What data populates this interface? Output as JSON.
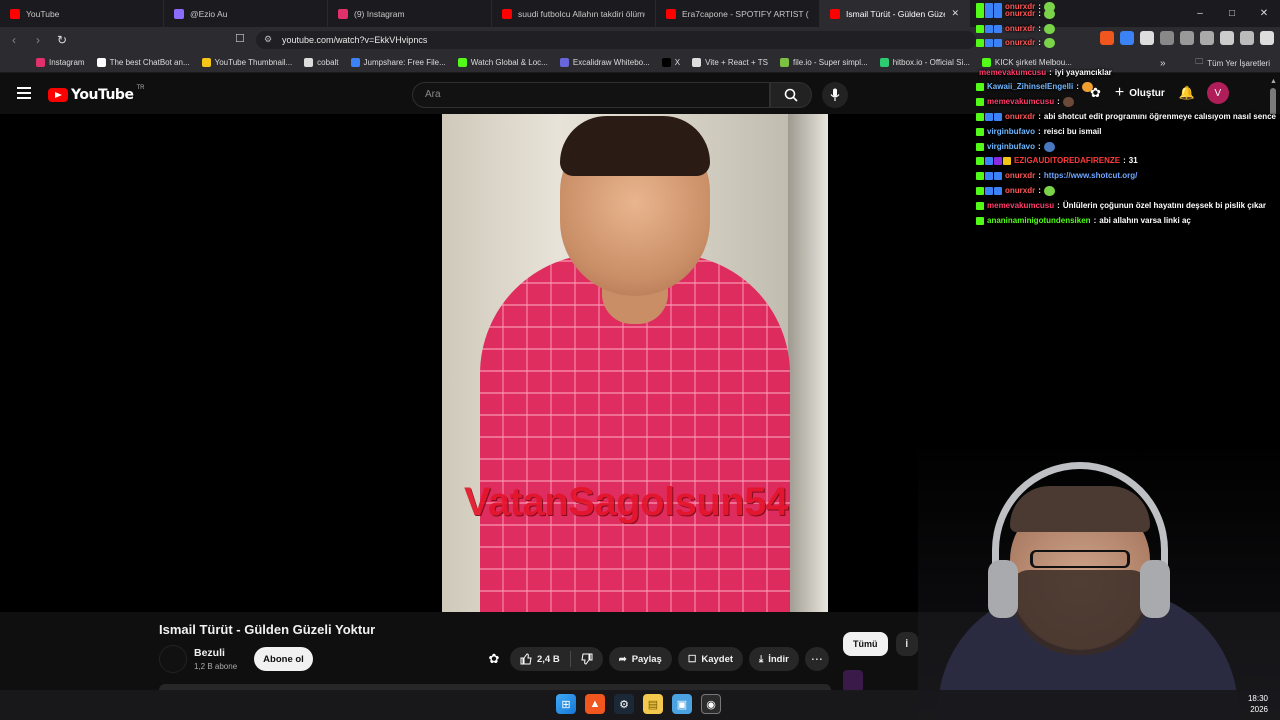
{
  "browser": {
    "tabs": [
      {
        "title": "YouTube",
        "color": "#ff0000"
      },
      {
        "title": "@Ezio Au",
        "color": "#8c6bff"
      },
      {
        "title": "(9) Instagram",
        "color": "#e1306c"
      },
      {
        "title": "suudi futbolcu Allahın takdiri ölümü",
        "color": "#ff0000"
      },
      {
        "title": "Era7capone - SPOTIFY ARTIST (Offici",
        "color": "#ff0000"
      },
      {
        "title": "Ismail Türüt - Gülden Güzeli Y",
        "color": "#ff0000",
        "active": true
      }
    ],
    "url": "youtube.com/watch?v=EkkVHvipncs",
    "bookmarks": [
      {
        "label": "Instagram",
        "color": "#e1306c"
      },
      {
        "label": "The best ChatBot an...",
        "color": "#ffffff"
      },
      {
        "label": "YouTube Thumbnail...",
        "color": "#f5c518"
      },
      {
        "label": "cobalt",
        "color": "#dddddd"
      },
      {
        "label": "Jumpshare: Free File...",
        "color": "#3b82f6"
      },
      {
        "label": "Watch Global & Loc...",
        "color": "#53fc18"
      },
      {
        "label": "Excalidraw Whitebo...",
        "color": "#6965db"
      },
      {
        "label": "X",
        "color": "#000000"
      },
      {
        "label": "Vite + React + TS",
        "color": "#dddddd"
      },
      {
        "label": "file.io - Super simpl...",
        "color": "#7cc142"
      },
      {
        "label": "hitbox.io - Official Si...",
        "color": "#2ecc71"
      },
      {
        "label": "KICK şirketi Melbou...",
        "color": "#53fc18"
      }
    ],
    "all_bookmarks": "Tüm Yer İşaretleri",
    "window_controls": [
      "–",
      "□",
      "✕"
    ]
  },
  "youtube": {
    "logo": "YouTube",
    "region": "TR",
    "search_placeholder": "Ara",
    "create_label": "Oluştur",
    "avatar_letter": "V",
    "video": {
      "title": "Ismail Türüt - Gülden Güzeli Yoktur",
      "watermark": "VatanSagolsun54",
      "channel": "Bezuli",
      "subscribers": "1,2 B abone",
      "subscribe_label": "Abone ol",
      "likes": "2,4 B",
      "share_label": "Paylaş",
      "save_label": "Kaydet",
      "download_label": "İndir"
    },
    "chips": [
      "Tümü",
      "İ"
    ]
  },
  "chat": [
    {
      "user": "onurxdr",
      "user_color": "#ff5555",
      "msg": "",
      "emote": "#7bd34a",
      "badges": [
        "#53fc18",
        "#3b82f6",
        "#3b82f6"
      ]
    },
    {
      "user": "onurxdr",
      "user_color": "#ff5555",
      "msg": "",
      "emote": "#7bd34a",
      "badges": [
        "#53fc18",
        "#3b82f6",
        "#3b82f6"
      ]
    },
    {
      "user": "onurxdr",
      "user_color": "#ff5555",
      "msg": "",
      "emote": "#7bd34a",
      "badges": [
        "#53fc18",
        "#3b82f6",
        "#3b82f6"
      ]
    },
    {
      "user": "onurxdr",
      "user_color": "#ff5555",
      "msg": "",
      "emote": "#7bd34a",
      "badges": [
        "#53fc18",
        "#3b82f6",
        "#3b82f6"
      ]
    },
    {
      "user": "memevakumcusu",
      "user_color": "#ff3b6b",
      "msg": "iyi yayamcıklar",
      "emote": "",
      "badges": []
    },
    {
      "user": "Kawaii_ZihinselEngelli",
      "user_color": "#6fb7ff",
      "msg": "",
      "emote": "#f0a030",
      "badges": [
        "#53fc18"
      ]
    },
    {
      "user": "memevakumcusu",
      "user_color": "#ff3b6b",
      "msg": "",
      "emote": "#6b4a3a",
      "badges": [
        "#53fc18"
      ]
    },
    {
      "user": "onurxdr",
      "user_color": "#ff5555",
      "msg": "abi shotcut edit programını öğrenmeye calısıyom nasıl sence",
      "emote": "",
      "badges": [
        "#53fc18",
        "#3b82f6",
        "#3b82f6"
      ]
    },
    {
      "user": "virginbufavo",
      "user_color": "#6fb7ff",
      "msg": "reisci bu ismail",
      "emote": "",
      "badges": [
        "#53fc18"
      ]
    },
    {
      "user": "virginbufavo",
      "user_color": "#6fb7ff",
      "msg": "",
      "emote": "#4a78c0",
      "badges": [
        "#53fc18"
      ]
    },
    {
      "user": "EZIGAUDITOREDAFIRENZE",
      "user_color": "#ff3b3b",
      "msg": "31",
      "emote": "",
      "badges": [
        "#53fc18",
        "#3b82f6",
        "#8a2be2",
        "#f5c518"
      ]
    },
    {
      "user": "onurxdr",
      "user_color": "#ff5555",
      "msg": "",
      "link": "https://www.shotcut.org/",
      "emote": "",
      "badges": [
        "#53fc18",
        "#3b82f6",
        "#3b82f6"
      ]
    },
    {
      "user": "onurxdr",
      "user_color": "#ff5555",
      "msg": "",
      "emote": "#7bd34a",
      "badges": [
        "#53fc18",
        "#3b82f6",
        "#3b82f6"
      ]
    },
    {
      "user": "memevakumcusu",
      "user_color": "#ff3b6b",
      "msg": "Ünlülerin çoğunun özel hayatını deşsek bi pislik çıkar",
      "emote": "",
      "badges": [
        "#53fc18"
      ]
    },
    {
      "user": "ananinaminigotundensiken",
      "user_color": "#53fc18",
      "msg": "abi allahın varsa linki aç",
      "emote": "",
      "badges": [
        "#53fc18"
      ]
    }
  ],
  "taskbar": {
    "time": "18:30",
    "date": "2026",
    "apps": [
      "windows",
      "brave",
      "steam",
      "files",
      "display",
      "obs"
    ]
  }
}
